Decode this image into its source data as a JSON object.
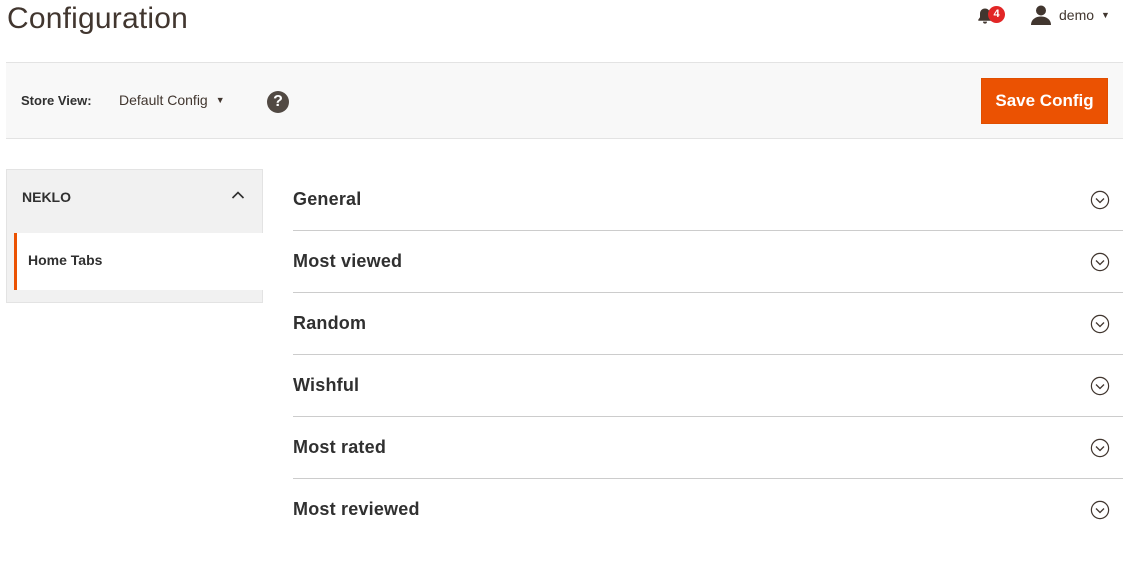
{
  "header": {
    "title": "Configuration",
    "notifications": {
      "count": "4",
      "icon": "bell-icon"
    },
    "user": {
      "name": "demo",
      "icon": "user-icon",
      "caret": "▼"
    }
  },
  "store_switcher": {
    "label": "Store View:",
    "selected": "Default Config",
    "caret": "▼",
    "help": "?"
  },
  "actions": {
    "save_label": "Save Config"
  },
  "sidebar": {
    "group_title": "NEKLO",
    "items": [
      {
        "label": "Home Tabs",
        "active": true
      }
    ]
  },
  "sections": [
    {
      "title": "General"
    },
    {
      "title": "Most viewed"
    },
    {
      "title": "Random"
    },
    {
      "title": "Wishful"
    },
    {
      "title": "Most rated"
    },
    {
      "title": "Most reviewed"
    }
  ],
  "colors": {
    "accent": "#eb5202",
    "badge": "#e22626",
    "text": "#303030",
    "bar_bg": "#f8f8f8",
    "sidebar_bg": "#f1f1f1"
  }
}
